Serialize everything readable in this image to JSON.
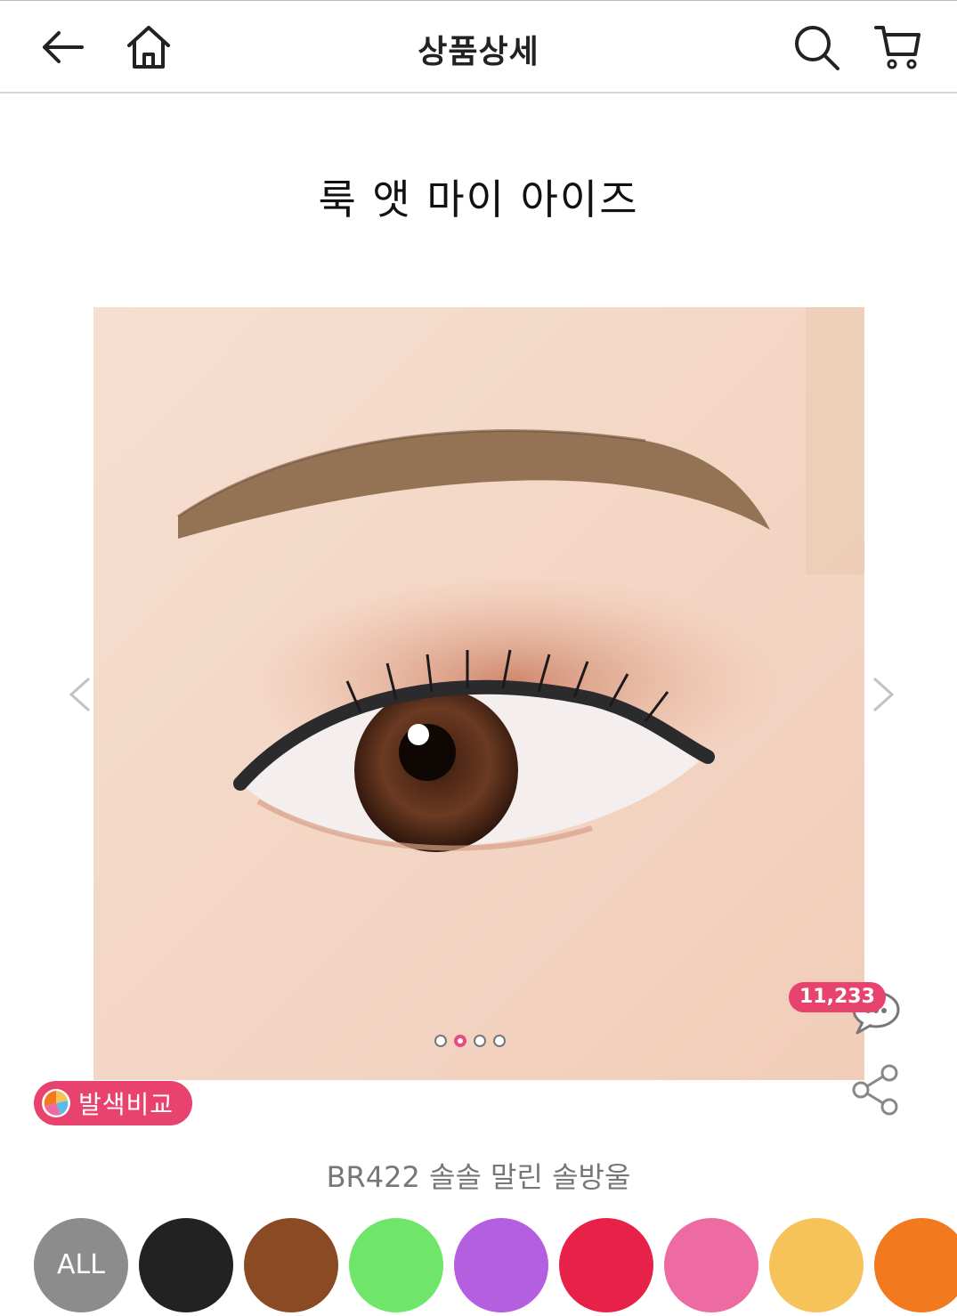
{
  "header": {
    "title": "상품상세"
  },
  "product": {
    "name": "룩 앳 마이 아이즈",
    "shade": "BR422 솔솔 말린 솔방울"
  },
  "gallery": {
    "total_slides": 4,
    "active_slide": 2
  },
  "review_count": "11,233",
  "swatch_compare_label": "발색비교",
  "color_filter": {
    "all_label": "ALL",
    "colors": [
      "#222222",
      "#8a4a24",
      "#6fe66a",
      "#b45fe0",
      "#e82148",
      "#ee6aa3",
      "#f6c25a",
      "#f2791e"
    ]
  },
  "accent_color": "#e8426f",
  "icons": [
    "back-arrow-icon",
    "home-icon",
    "search-icon",
    "cart-icon",
    "chevron-left-icon",
    "chevron-right-icon",
    "chat-icon",
    "share-icon",
    "palette-icon"
  ]
}
